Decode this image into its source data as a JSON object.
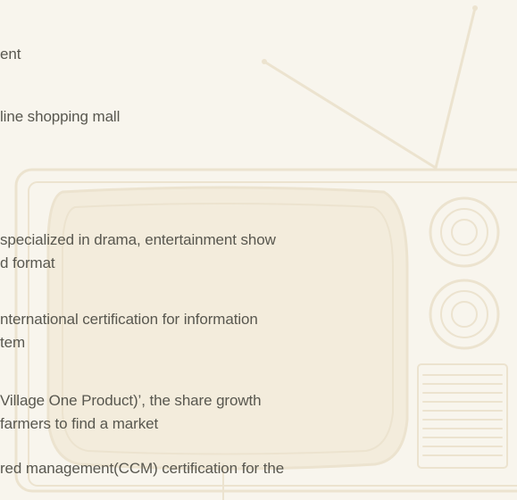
{
  "history": {
    "lines": [
      "ent",
      "line shopping mall",
      " specialized in drama, entertainment show",
      "d format",
      "nternational certification for information",
      "tem",
      "Village One Product)’, the share growth",
      "farmers to find a market",
      "red management(CCM) certification for the"
    ]
  },
  "decor": {
    "icon": "retro-tv-icon",
    "color": "#ece3cf"
  }
}
